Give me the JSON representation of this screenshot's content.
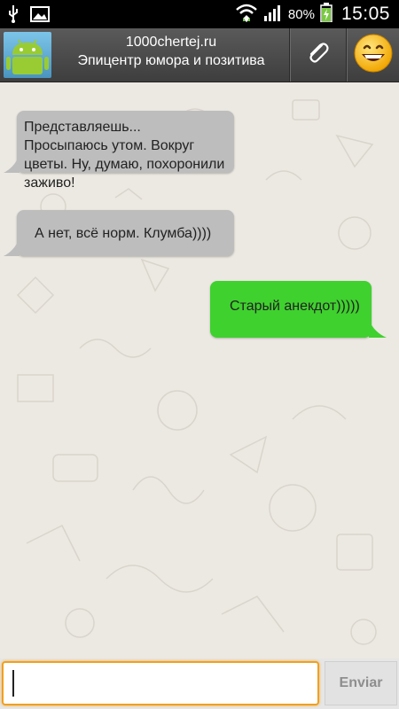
{
  "status_bar": {
    "battery_percent": "80%",
    "time": "15:05"
  },
  "header": {
    "title": "1000chertej.ru",
    "subtitle": "Эпицентр юмора и позитива",
    "attach_icon": "paperclip-icon",
    "emoji_icon": "smiley-icon",
    "avatar_icon": "android-icon"
  },
  "messages": [
    {
      "direction": "incoming",
      "text": "Представляешь... Просыпаюсь утом. Вокруг цветы. Ну, думаю, похоронили заживо!"
    },
    {
      "direction": "incoming",
      "text": "А нет, всё норм. Клумба))))"
    },
    {
      "direction": "outgoing",
      "text": "Старый анекдот)))))"
    }
  ],
  "composer": {
    "value": "",
    "placeholder": "",
    "send_label": "Enviar"
  },
  "colors": {
    "incoming_bubble": "#bdbdbd",
    "outgoing_bubble": "#3fd12e",
    "input_focus": "#f0a020"
  }
}
